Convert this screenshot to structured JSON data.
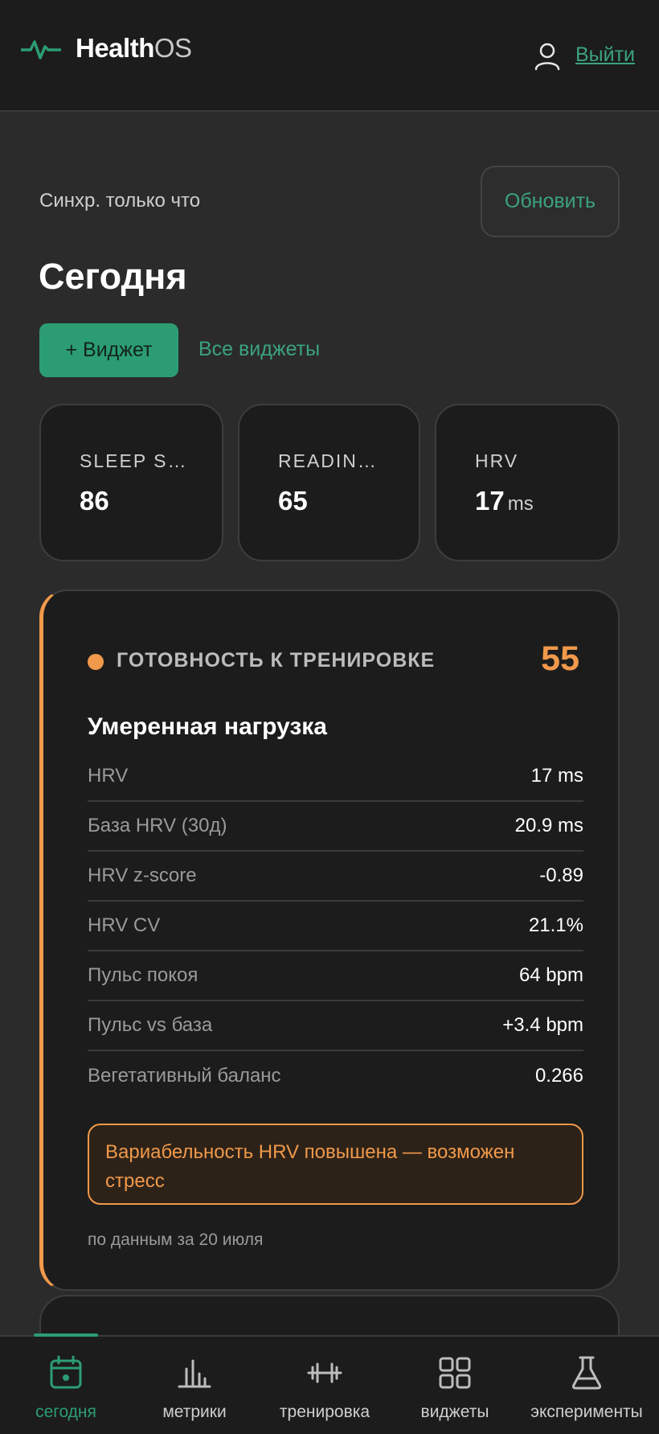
{
  "header": {
    "logo_bold": "Health",
    "logo_light": "OS",
    "logout_label": "Выйти"
  },
  "sync": {
    "status": "Синхр. только что",
    "refresh_label": "Обновить"
  },
  "page": {
    "title": "Сегодня",
    "add_widget_label": "+ Виджет",
    "all_widgets_label": "Все виджеты"
  },
  "tiles": [
    {
      "label": "SLEEP S…",
      "value": "86",
      "unit": ""
    },
    {
      "label": "READIN…",
      "value": "65",
      "unit": ""
    },
    {
      "label": "HRV",
      "value": "17",
      "unit": "ms"
    }
  ],
  "readiness": {
    "title": "ГОТОВНОСТЬ К ТРЕНИРОВКЕ",
    "score": "55",
    "subtitle": "Умеренная нагрузка",
    "rows": [
      {
        "key": "HRV",
        "value": "17 ms"
      },
      {
        "key": "База HRV (30д)",
        "value": "20.9 ms"
      },
      {
        "key": "HRV z-score",
        "value": "-0.89"
      },
      {
        "key": "HRV CV",
        "value": "21.1%"
      },
      {
        "key": "Пульс покоя",
        "value": "64 bpm"
      },
      {
        "key": "Пульс vs база",
        "value": "+3.4 bpm"
      },
      {
        "key": "Вегетативный баланс",
        "value": "0.266"
      }
    ],
    "alert": "Вариабельность HRV повышена — возможен стресс",
    "footnote": "по данным за 20 июля",
    "accent_color": "#f0994a"
  },
  "nav": {
    "active_color": "#2c9d73",
    "items": [
      {
        "label": "сегодня",
        "icon": "calendar-icon",
        "active": true
      },
      {
        "label": "метрики",
        "icon": "bar-chart-icon",
        "active": false
      },
      {
        "label": "тренировка",
        "icon": "dumbbell-icon",
        "active": false
      },
      {
        "label": "виджеты",
        "icon": "grid-icon",
        "active": false
      },
      {
        "label": "эксперименты",
        "icon": "flask-icon",
        "active": false
      }
    ]
  }
}
